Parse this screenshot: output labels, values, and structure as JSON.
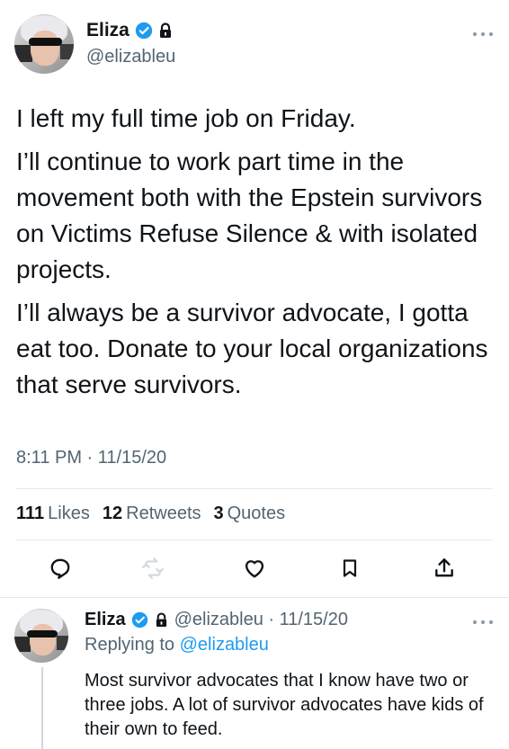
{
  "main_tweet": {
    "author": {
      "display_name": "Eliza",
      "handle": "@elizableu",
      "verified": true,
      "protected": true
    },
    "paragraphs": [
      "I left my full time job on Friday.",
      "I’ll continue to work part time in the movement both with the Epstein survivors on Victims Refuse Silence & with isolated projects.",
      "I’ll always be a survivor advocate, I gotta eat too. Donate to your local organizations that serve survivors."
    ],
    "timestamp": "8:11 PM · 11/15/20",
    "stats": {
      "likes_count": "111",
      "likes_label": "Likes",
      "retweets_count": "12",
      "retweets_label": "Retweets",
      "quotes_count": "3",
      "quotes_label": "Quotes"
    },
    "actions": [
      "reply-icon",
      "retweet-icon",
      "like-icon",
      "bookmark-icon",
      "share-icon"
    ]
  },
  "reply_tweet": {
    "author": {
      "display_name": "Eliza",
      "handle_date": "@elizableu · 11/15/20"
    },
    "replying_to_label": "Replying to",
    "replying_to_handle": "@elizableu",
    "text": "Most survivor advocates that I know have two or three jobs. A lot of survivor advocates have kids of their own to feed."
  },
  "colors": {
    "accent": "#1d9bf0",
    "secondary_text": "#536471",
    "primary_text": "#0f1419",
    "muted_icon": "#cfd9de"
  }
}
